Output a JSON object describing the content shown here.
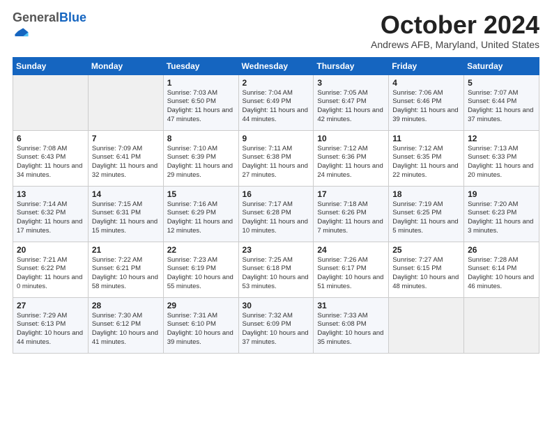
{
  "logo": {
    "general": "General",
    "blue": "Blue"
  },
  "header": {
    "title": "October 2024",
    "subtitle": "Andrews AFB, Maryland, United States"
  },
  "weekdays": [
    "Sunday",
    "Monday",
    "Tuesday",
    "Wednesday",
    "Thursday",
    "Friday",
    "Saturday"
  ],
  "weeks": [
    [
      null,
      null,
      {
        "day": "1",
        "sunrise": "Sunrise: 7:03 AM",
        "sunset": "Sunset: 6:50 PM",
        "daylight": "Daylight: 11 hours and 47 minutes."
      },
      {
        "day": "2",
        "sunrise": "Sunrise: 7:04 AM",
        "sunset": "Sunset: 6:49 PM",
        "daylight": "Daylight: 11 hours and 44 minutes."
      },
      {
        "day": "3",
        "sunrise": "Sunrise: 7:05 AM",
        "sunset": "Sunset: 6:47 PM",
        "daylight": "Daylight: 11 hours and 42 minutes."
      },
      {
        "day": "4",
        "sunrise": "Sunrise: 7:06 AM",
        "sunset": "Sunset: 6:46 PM",
        "daylight": "Daylight: 11 hours and 39 minutes."
      },
      {
        "day": "5",
        "sunrise": "Sunrise: 7:07 AM",
        "sunset": "Sunset: 6:44 PM",
        "daylight": "Daylight: 11 hours and 37 minutes."
      }
    ],
    [
      {
        "day": "6",
        "sunrise": "Sunrise: 7:08 AM",
        "sunset": "Sunset: 6:43 PM",
        "daylight": "Daylight: 11 hours and 34 minutes."
      },
      {
        "day": "7",
        "sunrise": "Sunrise: 7:09 AM",
        "sunset": "Sunset: 6:41 PM",
        "daylight": "Daylight: 11 hours and 32 minutes."
      },
      {
        "day": "8",
        "sunrise": "Sunrise: 7:10 AM",
        "sunset": "Sunset: 6:39 PM",
        "daylight": "Daylight: 11 hours and 29 minutes."
      },
      {
        "day": "9",
        "sunrise": "Sunrise: 7:11 AM",
        "sunset": "Sunset: 6:38 PM",
        "daylight": "Daylight: 11 hours and 27 minutes."
      },
      {
        "day": "10",
        "sunrise": "Sunrise: 7:12 AM",
        "sunset": "Sunset: 6:36 PM",
        "daylight": "Daylight: 11 hours and 24 minutes."
      },
      {
        "day": "11",
        "sunrise": "Sunrise: 7:12 AM",
        "sunset": "Sunset: 6:35 PM",
        "daylight": "Daylight: 11 hours and 22 minutes."
      },
      {
        "day": "12",
        "sunrise": "Sunrise: 7:13 AM",
        "sunset": "Sunset: 6:33 PM",
        "daylight": "Daylight: 11 hours and 20 minutes."
      }
    ],
    [
      {
        "day": "13",
        "sunrise": "Sunrise: 7:14 AM",
        "sunset": "Sunset: 6:32 PM",
        "daylight": "Daylight: 11 hours and 17 minutes."
      },
      {
        "day": "14",
        "sunrise": "Sunrise: 7:15 AM",
        "sunset": "Sunset: 6:31 PM",
        "daylight": "Daylight: 11 hours and 15 minutes."
      },
      {
        "day": "15",
        "sunrise": "Sunrise: 7:16 AM",
        "sunset": "Sunset: 6:29 PM",
        "daylight": "Daylight: 11 hours and 12 minutes."
      },
      {
        "day": "16",
        "sunrise": "Sunrise: 7:17 AM",
        "sunset": "Sunset: 6:28 PM",
        "daylight": "Daylight: 11 hours and 10 minutes."
      },
      {
        "day": "17",
        "sunrise": "Sunrise: 7:18 AM",
        "sunset": "Sunset: 6:26 PM",
        "daylight": "Daylight: 11 hours and 7 minutes."
      },
      {
        "day": "18",
        "sunrise": "Sunrise: 7:19 AM",
        "sunset": "Sunset: 6:25 PM",
        "daylight": "Daylight: 11 hours and 5 minutes."
      },
      {
        "day": "19",
        "sunrise": "Sunrise: 7:20 AM",
        "sunset": "Sunset: 6:23 PM",
        "daylight": "Daylight: 11 hours and 3 minutes."
      }
    ],
    [
      {
        "day": "20",
        "sunrise": "Sunrise: 7:21 AM",
        "sunset": "Sunset: 6:22 PM",
        "daylight": "Daylight: 11 hours and 0 minutes."
      },
      {
        "day": "21",
        "sunrise": "Sunrise: 7:22 AM",
        "sunset": "Sunset: 6:21 PM",
        "daylight": "Daylight: 10 hours and 58 minutes."
      },
      {
        "day": "22",
        "sunrise": "Sunrise: 7:23 AM",
        "sunset": "Sunset: 6:19 PM",
        "daylight": "Daylight: 10 hours and 55 minutes."
      },
      {
        "day": "23",
        "sunrise": "Sunrise: 7:25 AM",
        "sunset": "Sunset: 6:18 PM",
        "daylight": "Daylight: 10 hours and 53 minutes."
      },
      {
        "day": "24",
        "sunrise": "Sunrise: 7:26 AM",
        "sunset": "Sunset: 6:17 PM",
        "daylight": "Daylight: 10 hours and 51 minutes."
      },
      {
        "day": "25",
        "sunrise": "Sunrise: 7:27 AM",
        "sunset": "Sunset: 6:15 PM",
        "daylight": "Daylight: 10 hours and 48 minutes."
      },
      {
        "day": "26",
        "sunrise": "Sunrise: 7:28 AM",
        "sunset": "Sunset: 6:14 PM",
        "daylight": "Daylight: 10 hours and 46 minutes."
      }
    ],
    [
      {
        "day": "27",
        "sunrise": "Sunrise: 7:29 AM",
        "sunset": "Sunset: 6:13 PM",
        "daylight": "Daylight: 10 hours and 44 minutes."
      },
      {
        "day": "28",
        "sunrise": "Sunrise: 7:30 AM",
        "sunset": "Sunset: 6:12 PM",
        "daylight": "Daylight: 10 hours and 41 minutes."
      },
      {
        "day": "29",
        "sunrise": "Sunrise: 7:31 AM",
        "sunset": "Sunset: 6:10 PM",
        "daylight": "Daylight: 10 hours and 39 minutes."
      },
      {
        "day": "30",
        "sunrise": "Sunrise: 7:32 AM",
        "sunset": "Sunset: 6:09 PM",
        "daylight": "Daylight: 10 hours and 37 minutes."
      },
      {
        "day": "31",
        "sunrise": "Sunrise: 7:33 AM",
        "sunset": "Sunset: 6:08 PM",
        "daylight": "Daylight: 10 hours and 35 minutes."
      },
      null,
      null
    ]
  ]
}
